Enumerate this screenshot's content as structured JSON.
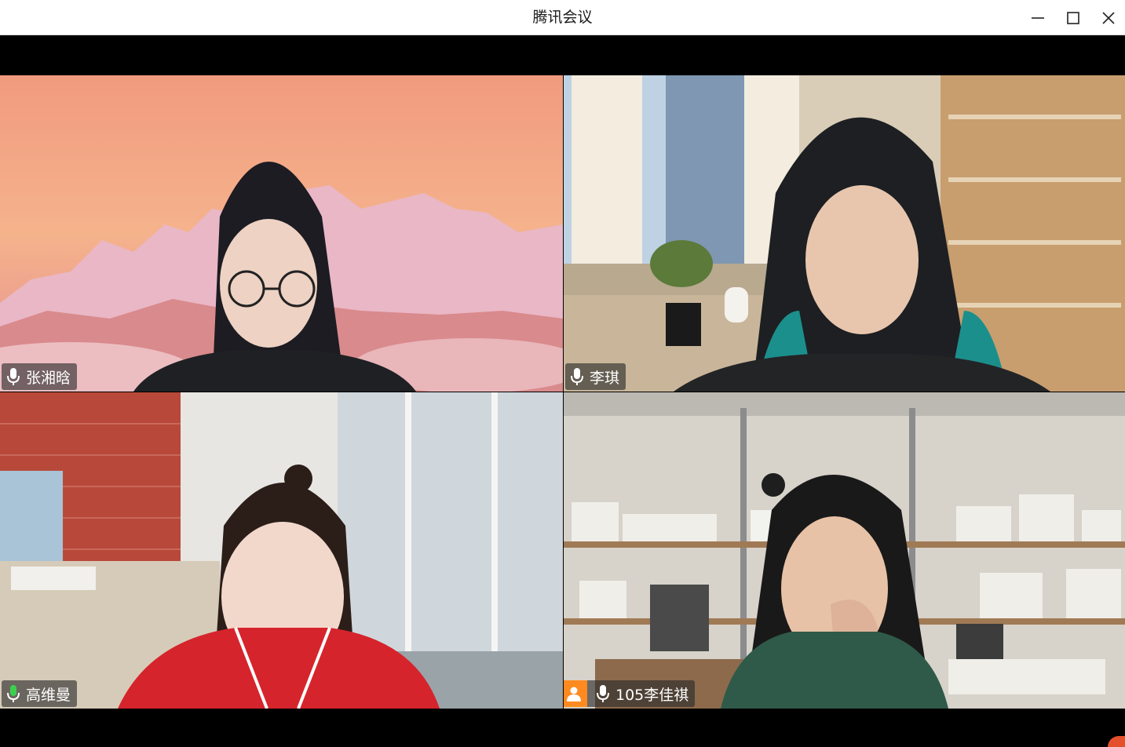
{
  "window": {
    "title": "腾讯会议",
    "controls": [
      "minimize-icon",
      "maximize-icon",
      "close-icon"
    ]
  },
  "participants": [
    {
      "name": "张湘晗",
      "mic": "muted-style",
      "mic_color": "#ffffff",
      "speaking": false
    },
    {
      "name": "李琪",
      "mic": "muted-style",
      "mic_color": "#ffffff",
      "speaking": false
    },
    {
      "name": "高维曼",
      "mic": "active",
      "mic_color": "#3ccf4e",
      "speaking": true
    },
    {
      "name": "105李佳祺",
      "mic": "muted-style",
      "mic_color": "#ffffff",
      "speaking": false,
      "badge": "user-avatar-icon"
    }
  ],
  "colors": {
    "speaking_border": "#3aa845",
    "badge_orange": "#ff8a1f"
  }
}
